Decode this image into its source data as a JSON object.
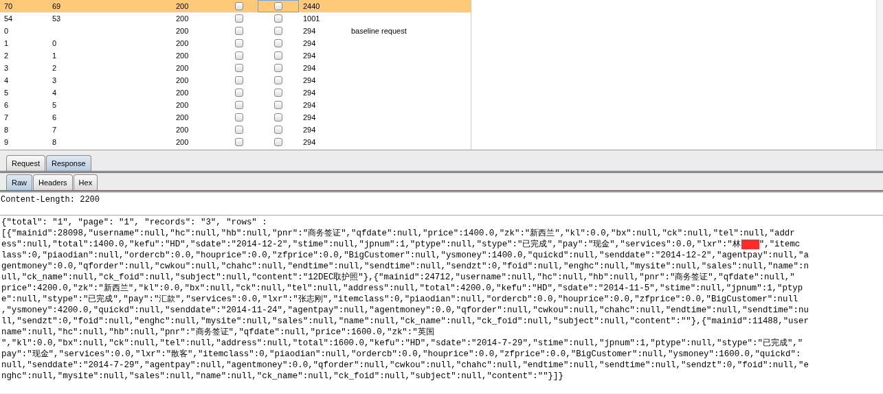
{
  "results_table": {
    "rows": [
      {
        "column_1": "70",
        "column_2": "69",
        "column_3": "200",
        "checkbox_1_checked": false,
        "checkbox_2_checked": false,
        "column_6": "2440",
        "selected": true
      },
      {
        "column_1": "54",
        "column_2": "53",
        "column_3": "200",
        "checkbox_1_checked": false,
        "checkbox_2_checked": false,
        "column_6": "1001",
        "selected": false
      },
      {
        "column_1": "0",
        "column_3": "200",
        "checkbox_1_checked": false,
        "checkbox_2_checked": false,
        "column_6": "294",
        "column_7": "baseline request",
        "selected": false
      },
      {
        "column_1": "1",
        "column_2": "0",
        "column_3": "200",
        "checkbox_1_checked": false,
        "checkbox_2_checked": false,
        "column_6": "294",
        "selected": false
      },
      {
        "column_1": "2",
        "column_2": "1",
        "column_3": "200",
        "checkbox_1_checked": false,
        "checkbox_2_checked": false,
        "column_6": "294",
        "selected": false
      },
      {
        "column_1": "3",
        "column_2": "2",
        "column_3": "200",
        "checkbox_1_checked": false,
        "checkbox_2_checked": false,
        "column_6": "294",
        "selected": false
      },
      {
        "column_1": "4",
        "column_2": "3",
        "column_3": "200",
        "checkbox_1_checked": false,
        "checkbox_2_checked": false,
        "column_6": "294",
        "selected": false
      },
      {
        "column_1": "5",
        "column_2": "4",
        "column_3": "200",
        "checkbox_1_checked": false,
        "checkbox_2_checked": false,
        "column_6": "294",
        "selected": false
      },
      {
        "column_1": "6",
        "column_2": "5",
        "column_3": "200",
        "checkbox_1_checked": false,
        "checkbox_2_checked": false,
        "column_6": "294",
        "selected": false
      },
      {
        "column_1": "7",
        "column_2": "6",
        "column_3": "200",
        "checkbox_1_checked": false,
        "checkbox_2_checked": false,
        "column_6": "294",
        "selected": false
      },
      {
        "column_1": "8",
        "column_2": "7",
        "column_3": "200",
        "checkbox_1_checked": false,
        "checkbox_2_checked": false,
        "column_6": "294",
        "selected": false
      },
      {
        "column_1": "9",
        "column_2": "8",
        "column_3": "200",
        "checkbox_1_checked": false,
        "checkbox_2_checked": false,
        "column_6": "294",
        "selected": false
      }
    ]
  },
  "message_tabs": [
    {
      "label": "Request",
      "selected": false
    },
    {
      "label": "Response",
      "selected": true
    }
  ],
  "view_tabs": [
    {
      "label": "Raw",
      "selected": true
    },
    {
      "label": "Headers",
      "selected": false
    },
    {
      "label": "Hex",
      "selected": false
    }
  ],
  "response": {
    "header_line": "Content-Length: 2200",
    "body_lines": [
      {
        "text": "{\"total\": \"1\", \"page\": \"1\", \"records\": \"3\", \"rows\" :"
      },
      {
        "text": "[{\"mainid\":28098,\"username\":null,\"hc\":null,\"hb\":null,\"pnr\":\"商务签证\",\"qfdate\":null,\"price\":1400.0,\"zk\":\"新西兰\",\"kl\":0.0,\"bx\":null,\"ck\":null,\"tel\":null,\"addr"
      },
      {
        "text": "ess\":null,\"total\":1400.0,\"kefu\":\"HD\",\"sdate\":\"2014-12-2\",\"stime\":null,\"jpnum\":1,\"ptype\":null,\"stype\":\"已完成\",\"pay\":\"现金\",\"services\":0.0,\"lxr\":\"林",
        "redacted": true,
        "after": "\",\"itemc"
      },
      {
        "text": "lass\":0,\"piaodian\":null,\"ordercb\":0.0,\"houprice\":0.0,\"zfprice\":0.0,\"BigCustomer\":null,\"ysmoney\":1400.0,\"quickd\":null,\"senddate\":\"2014-12-2\",\"agentpay\":null,\"a"
      },
      {
        "text": "gentmoney\":0.0,\"qforder\":null,\"cwkou\":null,\"chahc\":null,\"endtime\":null,\"sendtime\":null,\"sendzt\":0,\"foid\":null,\"enghc\":null,\"mysite\":null,\"sales\":null,\"name\":n"
      },
      {
        "text": "ull,\"ck_name\":null,\"ck_foid\":null,\"subject\":null,\"content\":\"12DEC取护照\"},{\"mainid\":24712,\"username\":null,\"hc\":null,\"hb\":null,\"pnr\":\"商务签证\",\"qfdate\":null,\""
      },
      {
        "text": "price\":4200.0,\"zk\":\"新西兰\",\"kl\":0.0,\"bx\":null,\"ck\":null,\"tel\":null,\"address\":null,\"total\":4200.0,\"kefu\":\"HD\",\"sdate\":\"2014-11-5\",\"stime\":null,\"jpnum\":1,\"ptyp"
      },
      {
        "text": "e\":null,\"stype\":\"已完成\",\"pay\":\"汇款\",\"services\":0.0,\"lxr\":\"张志刚\",\"itemclass\":0,\"piaodian\":null,\"ordercb\":0.0,\"houprice\":0.0,\"zfprice\":0.0,\"BigCustomer\":null"
      },
      {
        "text": ",\"ysmoney\":4200.0,\"quickd\":null,\"senddate\":\"2014-11-24\",\"agentpay\":null,\"agentmoney\":0.0,\"qforder\":null,\"cwkou\":null,\"chahc\":null,\"endtime\":null,\"sendtime\":nu"
      },
      {
        "text": "ll,\"sendzt\":0,\"foid\":null,\"enghc\":null,\"mysite\":null,\"sales\":null,\"name\":null,\"ck_name\":null,\"ck_foid\":null,\"subject\":null,\"content\":\"\"},{\"mainid\":11488,\"user"
      },
      {
        "text": "name\":null,\"hc\":null,\"hb\":null,\"pnr\":\"商务签证\",\"qfdate\":null,\"price\":1600.0,\"zk\":\"英国"
      },
      {
        "text": "\",\"kl\":0.0,\"bx\":null,\"ck\":null,\"tel\":null,\"address\":null,\"total\":1600.0,\"kefu\":\"HD\",\"sdate\":\"2014-7-29\",\"stime\":null,\"jpnum\":1,\"ptype\":null,\"stype\":\"已完成\",\""
      },
      {
        "text": "pay\":\"现金\",\"services\":0.0,\"lxr\":\"散客\",\"itemclass\":0,\"piaodian\":null,\"ordercb\":0.0,\"houprice\":0.0,\"zfprice\":0.0,\"BigCustomer\":null,\"ysmoney\":1600.0,\"quickd\":"
      },
      {
        "text": "null,\"senddate\":\"2014-7-29\",\"agentpay\":null,\"agentmoney\":0.0,\"qforder\":null,\"cwkou\":null,\"chahc\":null,\"endtime\":null,\"sendtime\":null,\"sendzt\":0,\"foid\":null,\"e"
      },
      {
        "text": "nghc\":null,\"mysite\":null,\"sales\":null,\"name\":null,\"ck_name\":null,\"ck_foid\":null,\"subject\":null,\"content\":\"\"}]}"
      }
    ]
  }
}
